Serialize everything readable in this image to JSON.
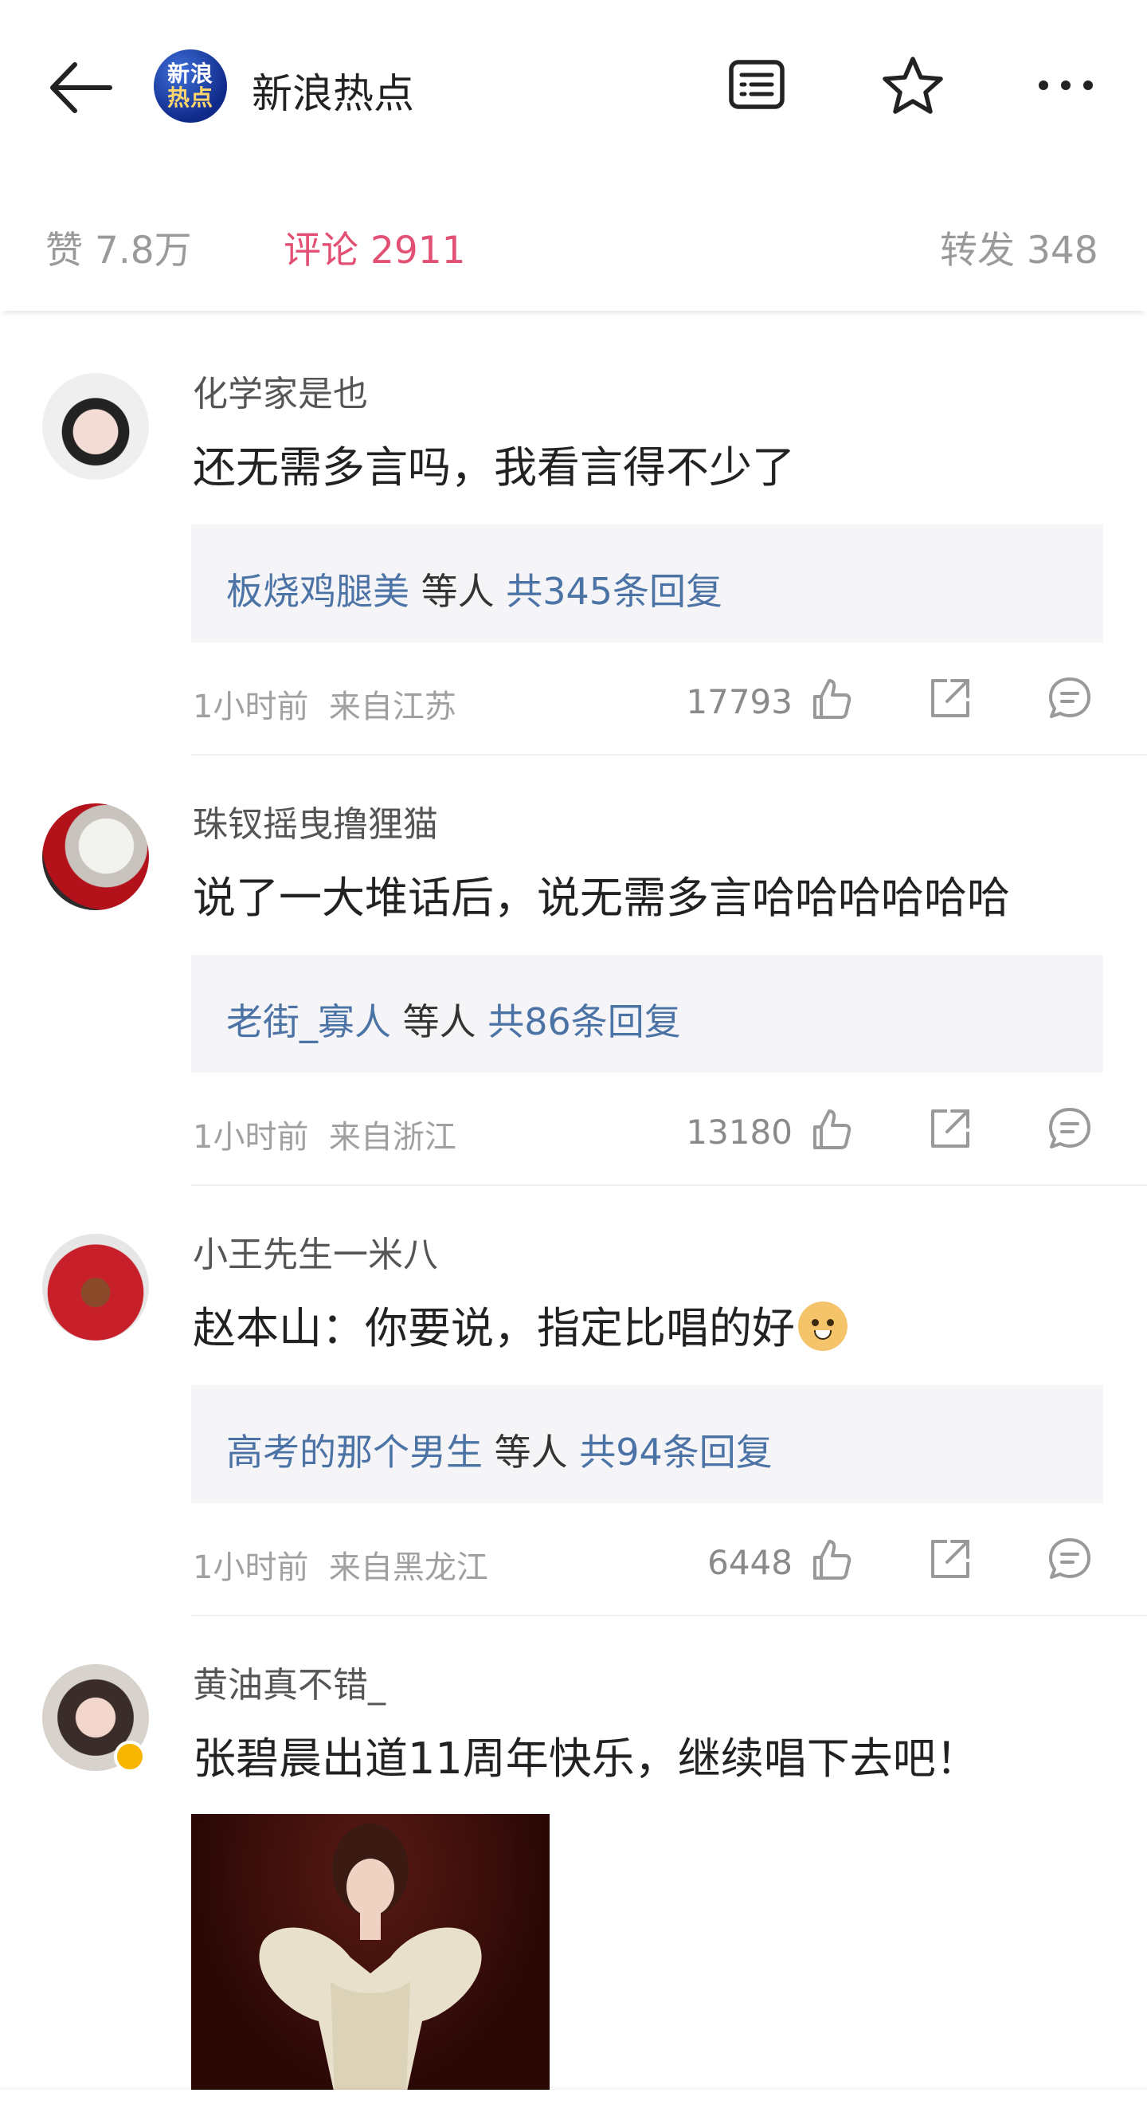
{
  "header": {
    "title": "新浪热点",
    "logo_text_1": "新浪",
    "logo_text_2": "热点",
    "back_icon": "back-arrow-icon",
    "article_icon": "article-icon",
    "star_icon": "star-icon",
    "more_icon": "more-icon"
  },
  "tabs": {
    "likes": "赞 7.8万",
    "comments": "评论 2911",
    "reposts": "转发 348"
  },
  "colors": {
    "accent": "#e25074",
    "link": "#4c73a6"
  },
  "comments": [
    {
      "user": "化学家是也",
      "text": "还无需多言吗，我看言得不少了",
      "reply_user": "板烧鸡腿美",
      "reply_mid": "等人",
      "reply_count": "共345条回复",
      "time": "1小时前",
      "location": "来自江苏",
      "likes": "17793"
    },
    {
      "user": "珠钗摇曳撸狸猫",
      "text": "说了一大堆话后，说无需多言哈哈哈哈哈哈",
      "reply_user": "老街_寡人",
      "reply_mid": "等人",
      "reply_count": "共86条回复",
      "time": "1小时前",
      "location": "来自浙江",
      "likes": "13180"
    },
    {
      "user": "小王先生一米八",
      "text": "赵本山：你要说，指定比唱的好",
      "reply_user": "高考的那个男生",
      "reply_mid": "等人",
      "reply_count": "共94条回复",
      "time": "1小时前",
      "location": "来自黑龙江",
      "likes": "6448"
    },
    {
      "user": "黄油真不错_",
      "text": "张碧晨出道11周年快乐，继续唱下去吧！"
    }
  ]
}
